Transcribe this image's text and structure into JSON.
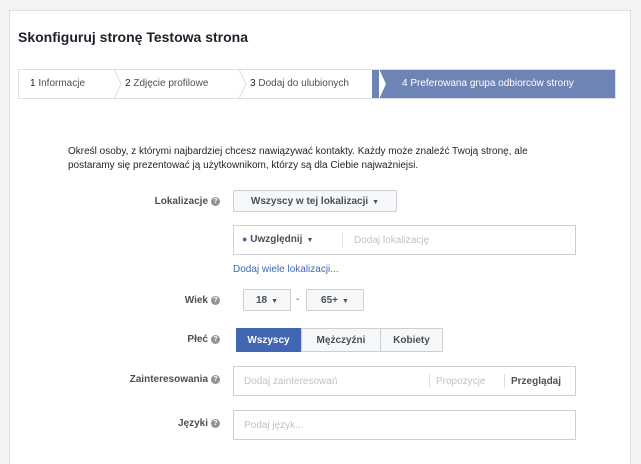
{
  "page": {
    "title": "Skonfiguruj stronę Testowa strona"
  },
  "steps": [
    {
      "num": "1",
      "label": "Informacje"
    },
    {
      "num": "2",
      "label": "Zdjęcie profilowe"
    },
    {
      "num": "3",
      "label": "Dodaj do ulubionych"
    },
    {
      "num": "4",
      "label": "Preferowana grupa odbiorców strony"
    }
  ],
  "description": "Określ osoby, z którymi najbardziej chcesz nawiązywać kontakty. Każdy może znaleźć Twoją stronę, ale postaramy się prezentować ją użytkownikom, którzy są dla Ciebie najważniejsi.",
  "location": {
    "label": "Lokalizacje",
    "dropdown": "Wszyscy w tej lokalizacji",
    "include": "Uwzględnij",
    "placeholder": "Dodaj lokalizację",
    "bulk_link": "Dodaj wiele lokalizacji..."
  },
  "age": {
    "label": "Wiek",
    "min": "18",
    "separator": "-",
    "max": "65+"
  },
  "gender": {
    "label": "Płeć",
    "options": [
      "Wszyscy",
      "Mężczyźni",
      "Kobiety"
    ],
    "selected": "Wszyscy"
  },
  "interests": {
    "label": "Zainteresowania",
    "placeholder": "Dodaj zainteresowań",
    "suggestions": "Propozycje",
    "browse": "Przeglądaj"
  },
  "languages": {
    "label": "Języki",
    "placeholder": "Podaj język..."
  },
  "colors": {
    "accent": "#4267b2",
    "step_active": "#6d84b4",
    "border": "#ccd0d5"
  }
}
